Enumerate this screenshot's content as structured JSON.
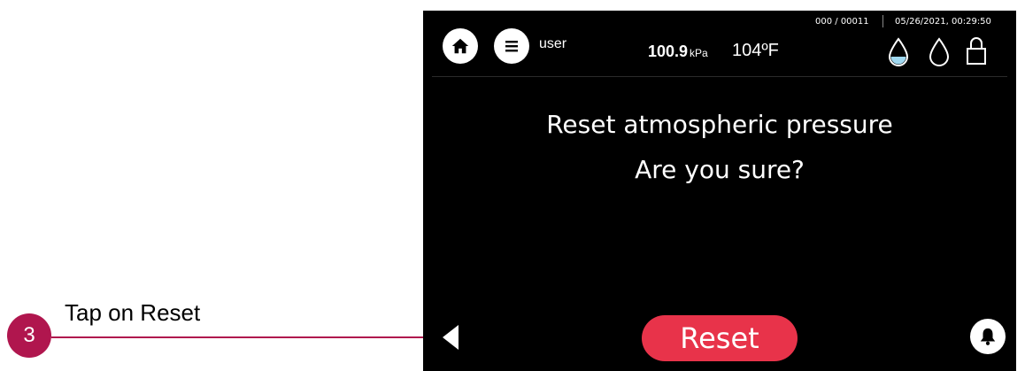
{
  "annotation": {
    "step_number": "3",
    "instruction": "Tap on Reset",
    "accent_color": "#b0164e"
  },
  "device": {
    "counter": "000 / 00011",
    "datetime": "05/26/2021, 00:29:50",
    "user": "user",
    "pressure_value": "100.9",
    "pressure_unit": "kPa",
    "temperature": "104ºF",
    "icons": [
      "home-icon",
      "menu-icon",
      "water-drop-filled-icon",
      "water-drop-icon",
      "lock-icon",
      "back-arrow-icon",
      "bell-icon"
    ],
    "message_line1": "Reset atmospheric pressure",
    "message_line2": "Are you sure?",
    "reset_label": "Reset",
    "reset_color": "#e8334a"
  }
}
